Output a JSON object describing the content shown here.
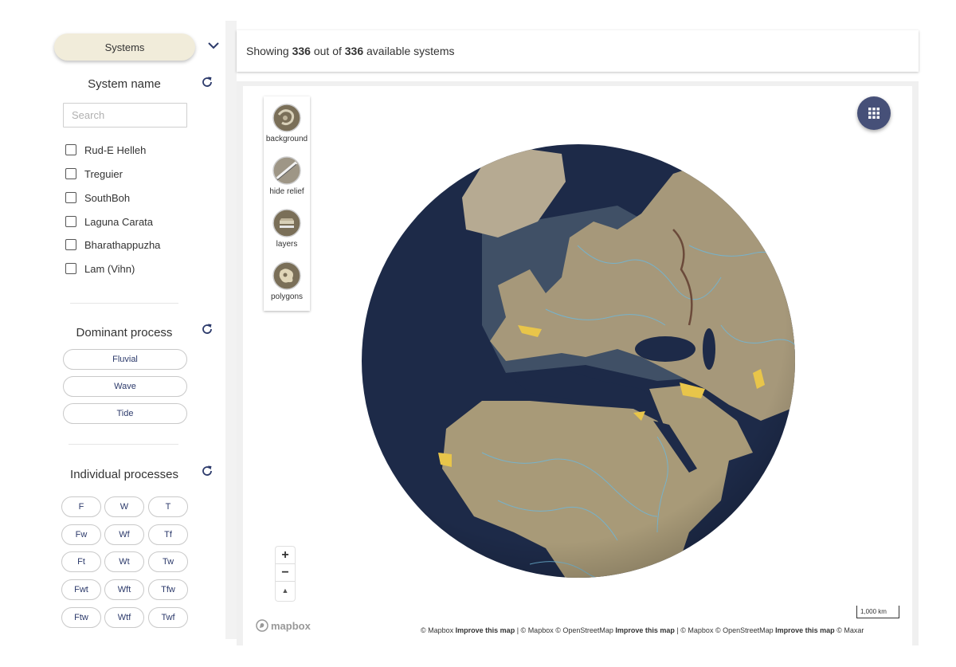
{
  "sidebar": {
    "systems_button": "Systems",
    "system_name_title": "System name",
    "search_placeholder": "Search",
    "systems": [
      {
        "label": "Rud-E Helleh",
        "checked": false
      },
      {
        "label": "Treguier",
        "checked": false
      },
      {
        "label": "SouthBoh",
        "checked": false
      },
      {
        "label": "Laguna Carata",
        "checked": false
      },
      {
        "label": "Bharathappuzha",
        "checked": false
      },
      {
        "label": "Lam (Vihn)",
        "checked": false
      }
    ],
    "dominant_title": "Dominant process",
    "dominant_processes": [
      "Fluvial",
      "Wave",
      "Tide"
    ],
    "individual_title": "Individual processes",
    "individual_processes": [
      [
        "F",
        "W",
        "T"
      ],
      [
        "Fw",
        "Wf",
        "Tf"
      ],
      [
        "Ft",
        "Wt",
        "Tw"
      ],
      [
        "Fwt",
        "Wft",
        "Tfw"
      ],
      [
        "Ftw",
        "Wtf",
        "Twf"
      ]
    ]
  },
  "header": {
    "showing_prefix": "Showing",
    "shown_count": "336",
    "out_of": "out of",
    "total_count": "336",
    "suffix": "available systems"
  },
  "map": {
    "layer_buttons": [
      {
        "label": "background",
        "icon": "background-icon"
      },
      {
        "label": "hide relief",
        "icon": "hide-relief-icon"
      },
      {
        "label": "layers",
        "icon": "layers-icon"
      },
      {
        "label": "polygons",
        "icon": "polygons-icon"
      }
    ],
    "zoom_in": "+",
    "zoom_out": "−",
    "compass": "▲",
    "logo_text": "mapbox",
    "scale_label": "1,000 km",
    "attribution": [
      {
        "text": "© Mapbox",
        "bold": false
      },
      {
        "text": "Improve this map",
        "bold": true
      },
      {
        "text": "| © Mapbox © OpenStreetMap",
        "bold": false
      },
      {
        "text": "Improve this map",
        "bold": true
      },
      {
        "text": "| © Mapbox © OpenStreetMap",
        "bold": false
      },
      {
        "text": "Improve this map",
        "bold": true
      },
      {
        "text": "© Maxar",
        "bold": false
      }
    ]
  },
  "colors": {
    "pill_bg": "#f1ecda",
    "ocean": "#1d2a48",
    "land": "#a89a78",
    "rivers": "#6fb7d9",
    "highlight": "#e8c54a",
    "fab": "#465078",
    "button_text": "#2c3a6b"
  }
}
